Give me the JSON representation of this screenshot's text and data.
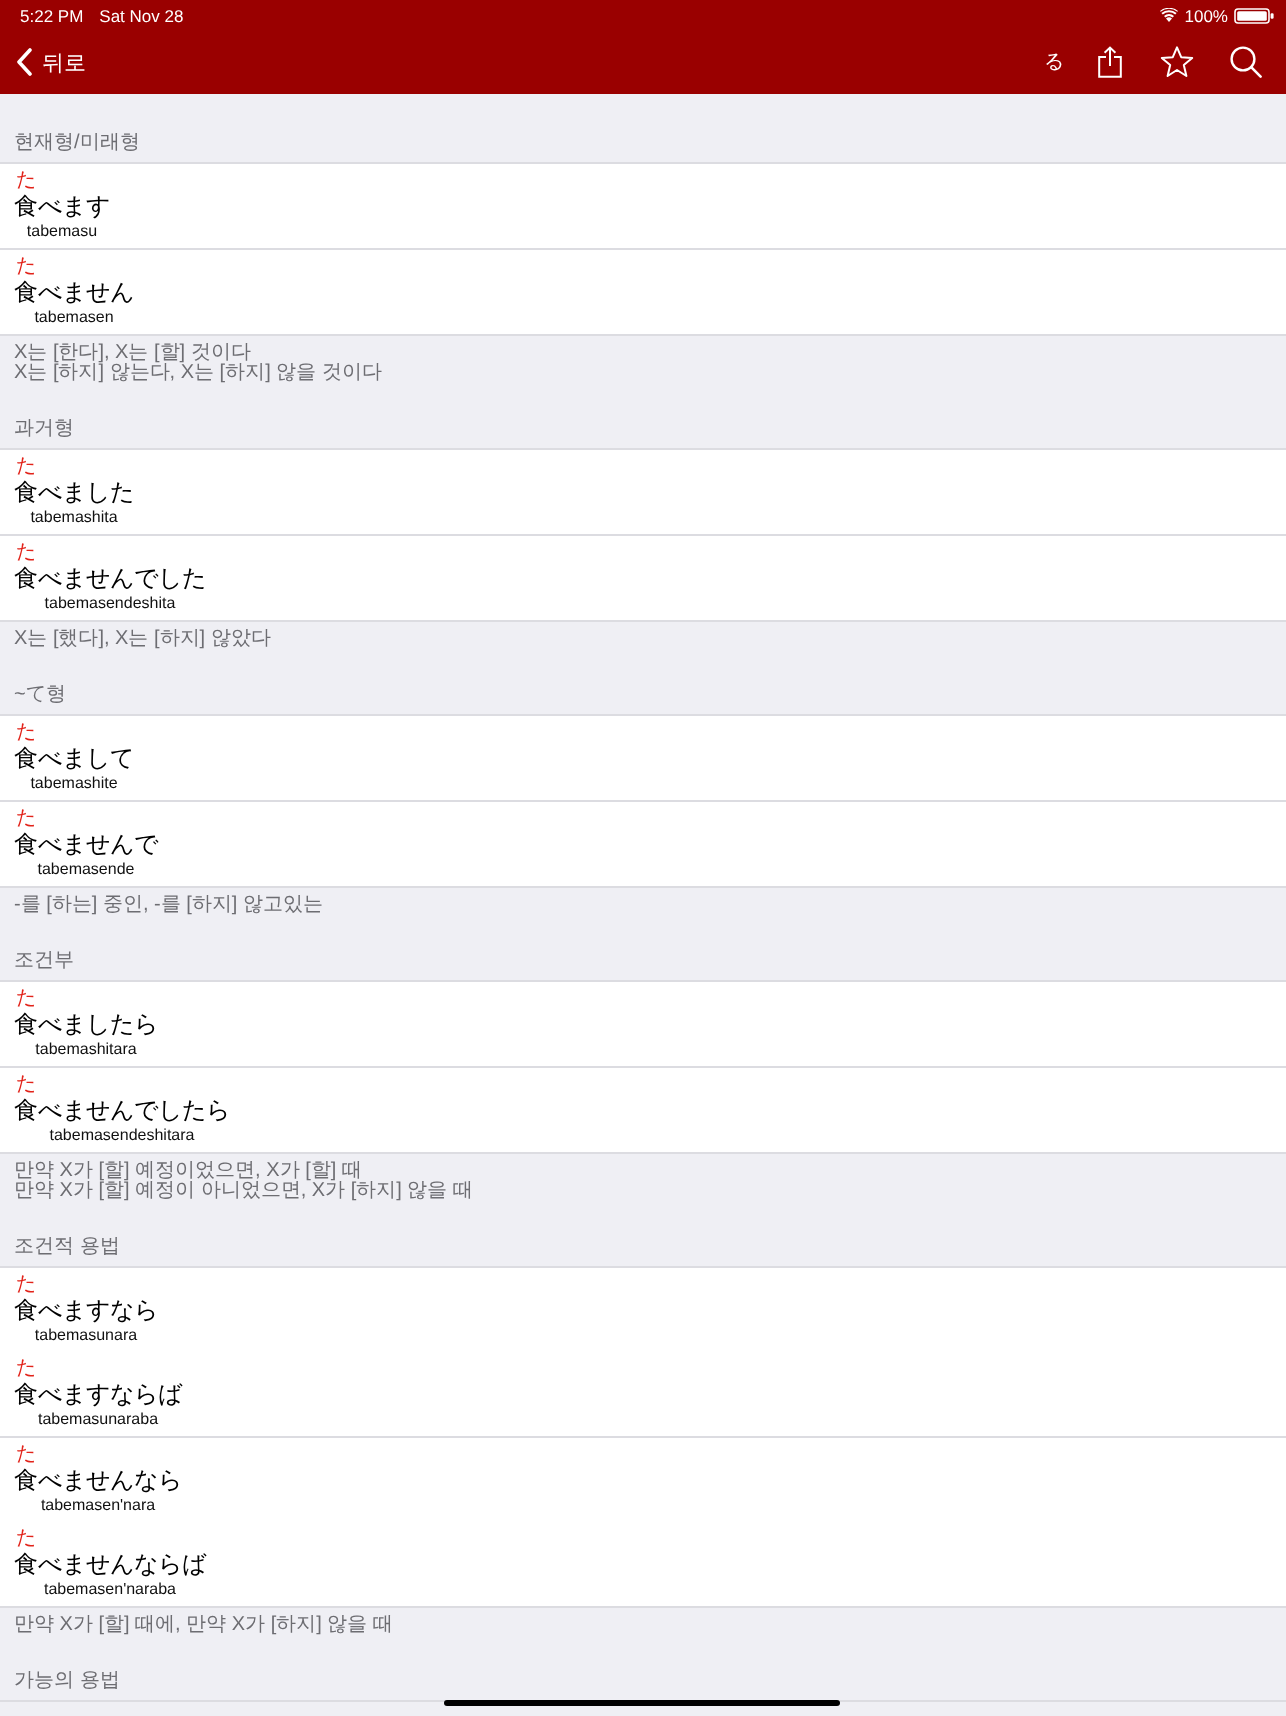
{
  "status_bar": {
    "time": "5:22 PM",
    "date": "Sat Nov 28",
    "battery": "100%"
  },
  "nav_bar": {
    "back_label": "뒤로",
    "form_button": "る"
  },
  "sections": [
    {
      "header": "현재형/미래형",
      "rows": [
        {
          "entries": [
            {
              "furigana": "た",
              "word": "食べます",
              "romaji": "tabemasu"
            }
          ]
        },
        {
          "entries": [
            {
              "furigana": "た",
              "word": "食べません",
              "romaji": "tabemasen"
            }
          ]
        }
      ],
      "notes": [
        "X는 [한다], X는 [할] 것이다",
        "X는 [하지] 않는다, X는 [하지] 않을 것이다"
      ]
    },
    {
      "header": "과거형",
      "rows": [
        {
          "entries": [
            {
              "furigana": "た",
              "word": "食べました",
              "romaji": "tabemashita"
            }
          ]
        },
        {
          "entries": [
            {
              "furigana": "た",
              "word": "食べませんでした",
              "romaji": "tabemasendeshita"
            }
          ]
        }
      ],
      "notes": [
        "X는 [했다], X는 [하지] 않았다"
      ]
    },
    {
      "header": "~て형",
      "rows": [
        {
          "entries": [
            {
              "furigana": "た",
              "word": "食べまして",
              "romaji": "tabemashite"
            }
          ]
        },
        {
          "entries": [
            {
              "furigana": "た",
              "word": "食べませんで",
              "romaji": "tabemasende"
            }
          ]
        }
      ],
      "notes": [
        "-를 [하는] 중인, -를 [하지] 않고있는"
      ]
    },
    {
      "header": "조건부",
      "rows": [
        {
          "entries": [
            {
              "furigana": "た",
              "word": "食べましたら",
              "romaji": "tabemashitara"
            }
          ]
        },
        {
          "entries": [
            {
              "furigana": "た",
              "word": "食べませんでしたら",
              "romaji": "tabemasendeshitara"
            }
          ]
        }
      ],
      "notes": [
        "만약 X가 [할] 예정이었으면, X가 [할] 때",
        "만약 X가 [할] 예정이 아니었으면, X가 [하지] 않을 때"
      ]
    },
    {
      "header": "조건적 용법",
      "rows": [
        {
          "entries": [
            {
              "furigana": "た",
              "word": "食べますなら",
              "romaji": "tabemasunara"
            },
            {
              "furigana": "た",
              "word": "食べますならば",
              "romaji": "tabemasunaraba"
            }
          ]
        },
        {
          "entries": [
            {
              "furigana": "た",
              "word": "食べませんなら",
              "romaji": "tabemasen'nara"
            },
            {
              "furigana": "た",
              "word": "食べませんならば",
              "romaji": "tabemasen'naraba"
            }
          ]
        }
      ],
      "notes": [
        "만약 X가 [할] 때에, 만약 X가 [하지] 않을 때"
      ]
    },
    {
      "header": "가능의 용법"
    }
  ]
}
